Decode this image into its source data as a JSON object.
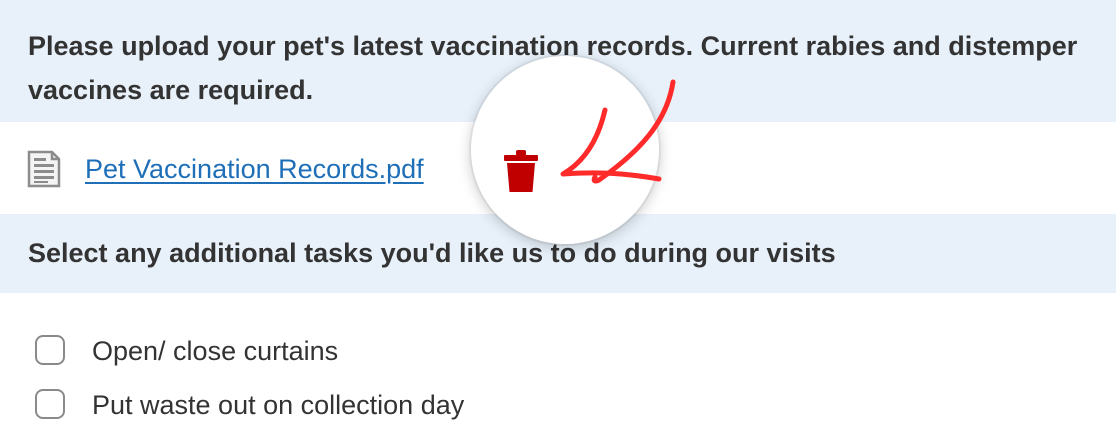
{
  "upload_section": {
    "instruction": "Please upload your pet's latest vaccination records. Current rabies and distemper vaccines are required."
  },
  "uploaded_file": {
    "icon": "document-icon",
    "name": "Pet Vaccination Records.pdf",
    "delete_icon": "trash-icon",
    "delete_color": "#c00000"
  },
  "annotation": {
    "arrow_color": "#ff2a2a"
  },
  "tasks_section": {
    "heading": "Select any additional tasks you'd like us to do during our visits",
    "options": [
      {
        "label": "Open/ close curtains",
        "checked": false
      },
      {
        "label": "Put waste out on collection day",
        "checked": false
      }
    ]
  },
  "colors": {
    "header_background": "#e8f1fa",
    "link": "#1e6fb8",
    "text": "#333333"
  }
}
